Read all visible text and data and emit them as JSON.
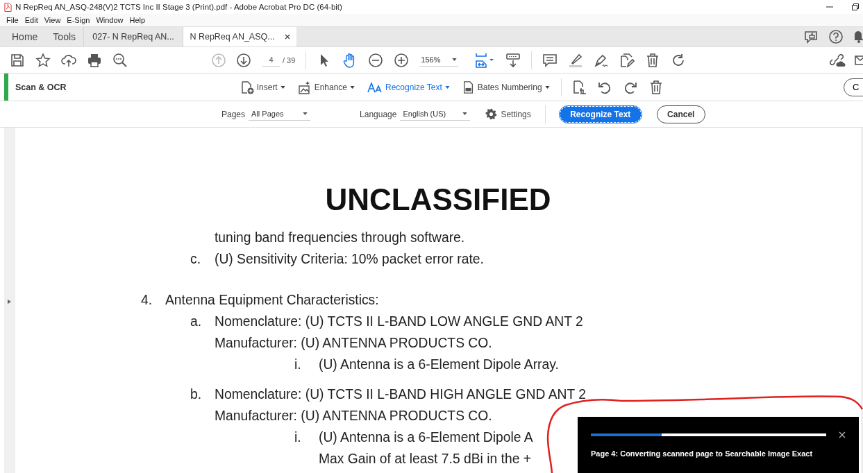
{
  "window": {
    "title": "N RepReq AN_ASQ-248(V)2 TCTS Inc II Stage 3 (Print).pdf - Adobe Acrobat Pro DC (64-bit)"
  },
  "menu": [
    "File",
    "Edit",
    "View",
    "E-Sign",
    "Window",
    "Help"
  ],
  "tabs": [
    {
      "label": "Home",
      "kind": "nav",
      "selected": false
    },
    {
      "label": "Tools",
      "kind": "nav",
      "selected": false
    },
    {
      "label": "027- N RepReq AN...",
      "kind": "document",
      "selected": false
    },
    {
      "label": "N RepReq AN_ASQ...",
      "kind": "document",
      "selected": true
    }
  ],
  "toolbar": {
    "page": "4",
    "page_count": "/ 39",
    "zoom": "156%",
    "previous_page_disabled": true,
    "hand_tool_selected": true
  },
  "scan_bar": {
    "title": "Scan & OCR",
    "menus": [
      {
        "label": "Insert",
        "selected": false
      },
      {
        "label": "Enhance",
        "selected": false
      },
      {
        "label": "Recognize Text",
        "selected": true
      },
      {
        "label": "Bates Numbering",
        "selected": false
      }
    ],
    "close_button": "C"
  },
  "options": {
    "pages_label": "Pages",
    "pages_value": "All Pages",
    "language_label": "Language",
    "language_value": "English (US)",
    "settings": "Settings",
    "primary_button": "Recognize Text",
    "cancel_button": "Cancel"
  },
  "document": {
    "heading": "UNCLASSIFIED",
    "items": [
      {
        "children": [
          {
            "text": "tuning band frequencies through software."
          },
          {
            "marker": "c.",
            "text": "(U) Sensitivity Criteria: 10% packet error rate."
          }
        ]
      },
      {
        "marker": "4.",
        "text": "Antenna Equipment Characteristics:",
        "children": [
          {
            "marker": "a.",
            "text": "Nomenclature: (U) TCTS II L-BAND LOW ANGLE GND ANT 2",
            "lines": [
              "Manufacturer: (U) ANTENNA PRODUCTS CO."
            ],
            "children": [
              {
                "marker": "i.",
                "text": "(U) Antenna is a 6-Element Dipole Array."
              }
            ]
          },
          {
            "marker": "b.",
            "text": "Nomenclature: (U) TCTS II L-BAND HIGH ANGLE GND ANT 2",
            "lines": [
              "Manufacturer: (U) ANTENNA PRODUCTS CO."
            ],
            "children": [
              {
                "marker": "i.",
                "text": "(U) Antenna is a 6-Element Dipole A",
                "lines": [
                  "Max Gain of at least 7.5 dBi in the +"
                ]
              }
            ]
          }
        ]
      }
    ]
  },
  "toast": {
    "level": 0.3,
    "message": "Page 4: Converting scanned page to Searchable Image Exact"
  }
}
